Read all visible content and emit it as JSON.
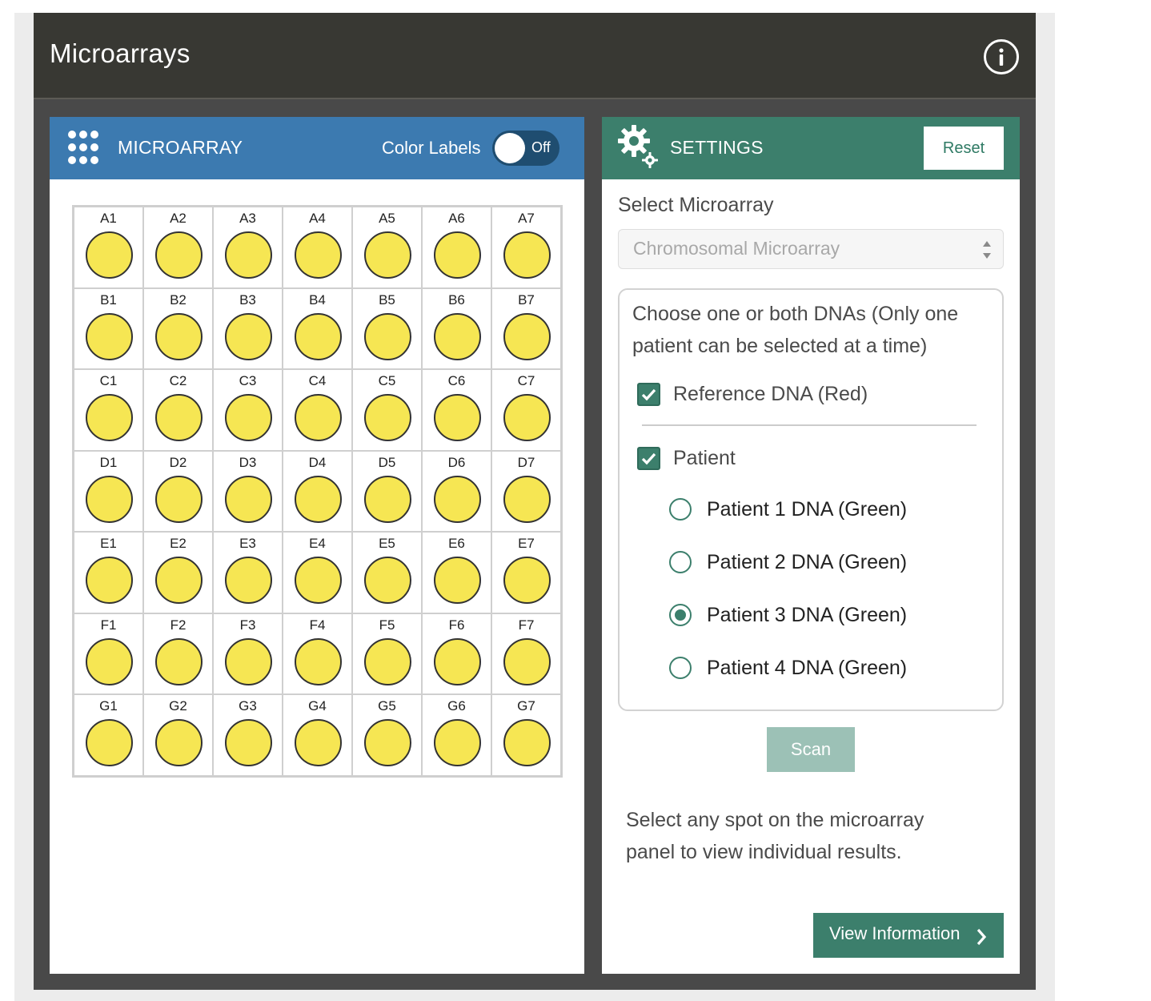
{
  "app": {
    "title": "Microarrays",
    "info_icon": "info-circle-icon"
  },
  "microarray_panel": {
    "icon": "grid-dots-icon",
    "title": "MICROARRAY",
    "color_labels_label": "Color Labels",
    "color_labels_toggle": {
      "state": "Off",
      "on": false
    },
    "spot_color": "#f6e653",
    "rows": [
      [
        "A1",
        "A2",
        "A3",
        "A4",
        "A5",
        "A6",
        "A7"
      ],
      [
        "B1",
        "B2",
        "B3",
        "B4",
        "B5",
        "B6",
        "B7"
      ],
      [
        "C1",
        "C2",
        "C3",
        "C4",
        "C5",
        "C6",
        "C7"
      ],
      [
        "D1",
        "D2",
        "D3",
        "D4",
        "D5",
        "D6",
        "D7"
      ],
      [
        "E1",
        "E2",
        "E3",
        "E4",
        "E5",
        "E6",
        "E7"
      ],
      [
        "F1",
        "F2",
        "F3",
        "F4",
        "F5",
        "F6",
        "F7"
      ],
      [
        "G1",
        "G2",
        "G3",
        "G4",
        "G5",
        "G6",
        "G7"
      ]
    ]
  },
  "settings_panel": {
    "icon": "gear-icon",
    "title": "SETTINGS",
    "reset_label": "Reset",
    "select_label": "Select Microarray",
    "select_value": "Chromosomal Microarray",
    "dna_instructions": "Choose one or both DNAs (Only one patient can be selected at a time)",
    "reference": {
      "label": "Reference DNA (Red)",
      "checked": true
    },
    "patient": {
      "label": "Patient",
      "checked": true
    },
    "patient_options": [
      {
        "label": "Patient 1 DNA (Green)",
        "selected": false
      },
      {
        "label": "Patient 2 DNA (Green)",
        "selected": false
      },
      {
        "label": "Patient 3 DNA (Green)",
        "selected": true
      },
      {
        "label": "Patient 4 DNA (Green)",
        "selected": false
      }
    ],
    "scan_label": "Scan",
    "hint": "Select any spot on the microarray panel to view individual results.",
    "view_info_label": "View Information",
    "view_info_icon": "chevron-right-icon"
  },
  "colors": {
    "header_bg": "#383833",
    "microarray_header": "#3c7ab0",
    "settings_header": "#3c7f6c",
    "scan_disabled": "#9cc1b6"
  }
}
